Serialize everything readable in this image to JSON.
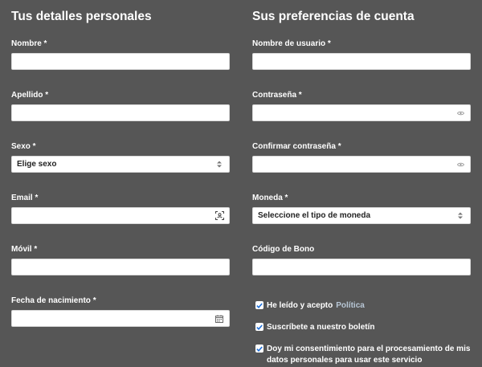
{
  "left": {
    "heading": "Tus detalles personales",
    "fields": {
      "nombre": {
        "label": "Nombre *",
        "value": ""
      },
      "apellido": {
        "label": "Apellido *",
        "value": ""
      },
      "sexo": {
        "label": "Sexo *",
        "value": "Elige sexo"
      },
      "email": {
        "label": "Email *",
        "value": ""
      },
      "movil": {
        "label": "Móvil *",
        "value": ""
      },
      "fecha": {
        "label": "Fecha de nacimiento *",
        "value": ""
      }
    }
  },
  "right": {
    "heading": "Sus preferencias de cuenta",
    "fields": {
      "usuario": {
        "label": "Nombre de usuario *",
        "value": ""
      },
      "contrasena": {
        "label": "Contraseña *",
        "value": ""
      },
      "confirmar": {
        "label": "Confirmar contraseña *",
        "value": ""
      },
      "moneda": {
        "label": "Moneda *",
        "value": "Seleccione el tipo de moneda"
      },
      "bono": {
        "label": "Código de Bono",
        "value": ""
      }
    },
    "checks": {
      "politica": {
        "text": "He leído y acepto",
        "link": "Política",
        "checked": true
      },
      "boletin": {
        "text": "Suscríbete a nuestro boletín",
        "checked": true
      },
      "consentimiento": {
        "text": "Doy mi consentimiento para el procesamiento de mis datos personales para usar este servicio",
        "checked": true
      }
    }
  },
  "icons": {
    "select": "updown-caret-icon",
    "email": "autofill-contact-icon",
    "password": "eye-icon",
    "date": "calendar-icon",
    "checkbox": "checkmark-icon"
  },
  "colors": {
    "background": "#565656",
    "input": "#ffffff",
    "check_accent": "#1e6fd9",
    "link": "#b8c7d6"
  }
}
